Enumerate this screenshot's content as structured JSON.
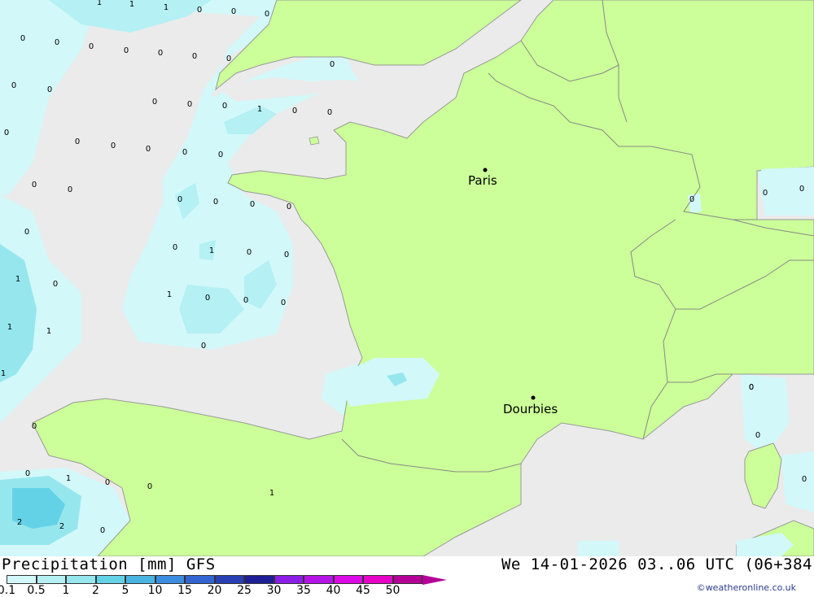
{
  "map": {
    "title": "Precipitation [mm] GFS",
    "validity": "We 14-01-2026 03..06 UTC (06+384",
    "credit": "©weatheronline.co.uk",
    "colors": {
      "sea": "#ebebeb",
      "land": "#ccff99",
      "border": "#888888",
      "coast": "#999999"
    },
    "cities": [
      {
        "name": "Paris"
      },
      {
        "name": "Dourbies"
      }
    ],
    "legend": [
      {
        "label": "0.1",
        "color": "#d2f8fa"
      },
      {
        "label": "0.5",
        "color": "#b4f0f4"
      },
      {
        "label": "1",
        "color": "#96e6ee"
      },
      {
        "label": "2",
        "color": "#64d2e6"
      },
      {
        "label": "5",
        "color": "#4ab4e0"
      },
      {
        "label": "10",
        "color": "#3c8ce0"
      },
      {
        "label": "15",
        "color": "#3264d2"
      },
      {
        "label": "20",
        "color": "#2840b4"
      },
      {
        "label": "25",
        "color": "#1e1e96"
      },
      {
        "label": "30",
        "color": "#8c1ee6"
      },
      {
        "label": "35",
        "color": "#b414e6"
      },
      {
        "label": "40",
        "color": "#dc0ae6"
      },
      {
        "label": "45",
        "color": "#e600c8"
      },
      {
        "label": "50",
        "color": "#b40096"
      }
    ],
    "values": [
      "1",
      "1",
      "1",
      "0",
      "0",
      "0",
      "0",
      "0",
      "0",
      "0",
      "0",
      "0",
      "0",
      "0",
      "0",
      "0",
      "0",
      "0",
      "1",
      "0",
      "0",
      "0",
      "0",
      "0",
      "0",
      "0",
      "0",
      "0",
      "0",
      "0",
      "0",
      "0",
      "0",
      "0",
      "0",
      "0",
      "1",
      "0",
      "0",
      "1",
      "0",
      "0",
      "1",
      "0",
      "0",
      "1",
      "1",
      "1",
      "0",
      "0",
      "0",
      "1",
      "0",
      "0",
      "2",
      "2",
      "0",
      "1",
      "0",
      "0",
      "0",
      "0",
      "0",
      "0",
      "0"
    ]
  }
}
